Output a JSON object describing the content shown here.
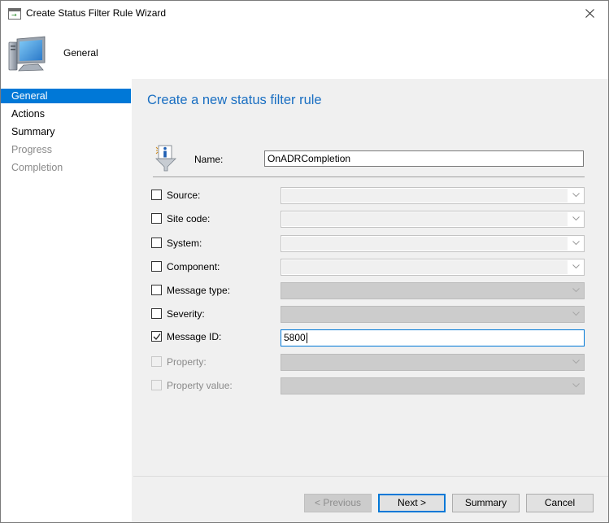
{
  "window": {
    "title": "Create Status Filter Rule Wizard"
  },
  "header": {
    "title": "General"
  },
  "sidebar": {
    "items": [
      {
        "label": "General",
        "state": "active"
      },
      {
        "label": "Actions",
        "state": "normal"
      },
      {
        "label": "Summary",
        "state": "normal"
      },
      {
        "label": "Progress",
        "state": "disabled"
      },
      {
        "label": "Completion",
        "state": "disabled"
      }
    ]
  },
  "main": {
    "title": "Create a new status filter rule",
    "name_label": "Name:",
    "name_value": "OnADRCompletion",
    "criteria": [
      {
        "label": "Source:",
        "checked": false,
        "enabled": true,
        "value": ""
      },
      {
        "label": "Site code:",
        "checked": false,
        "enabled": true,
        "value": ""
      },
      {
        "label": "System:",
        "checked": false,
        "enabled": true,
        "value": ""
      },
      {
        "label": "Component:",
        "checked": false,
        "enabled": true,
        "value": ""
      },
      {
        "label": "Message type:",
        "checked": false,
        "enabled": true,
        "value": ""
      },
      {
        "label": "Severity:",
        "checked": false,
        "enabled": true,
        "value": ""
      },
      {
        "label": "Message ID:",
        "checked": true,
        "enabled": true,
        "value": "5800"
      },
      {
        "label": "Property:",
        "checked": false,
        "enabled": false,
        "value": ""
      },
      {
        "label": "Property value:",
        "checked": false,
        "enabled": false,
        "value": ""
      }
    ]
  },
  "buttons": {
    "previous": "< Previous",
    "next": "Next >",
    "summary": "Summary",
    "cancel": "Cancel"
  },
  "colors": {
    "accent": "#0078d7",
    "title_blue": "#1a6fc2"
  }
}
